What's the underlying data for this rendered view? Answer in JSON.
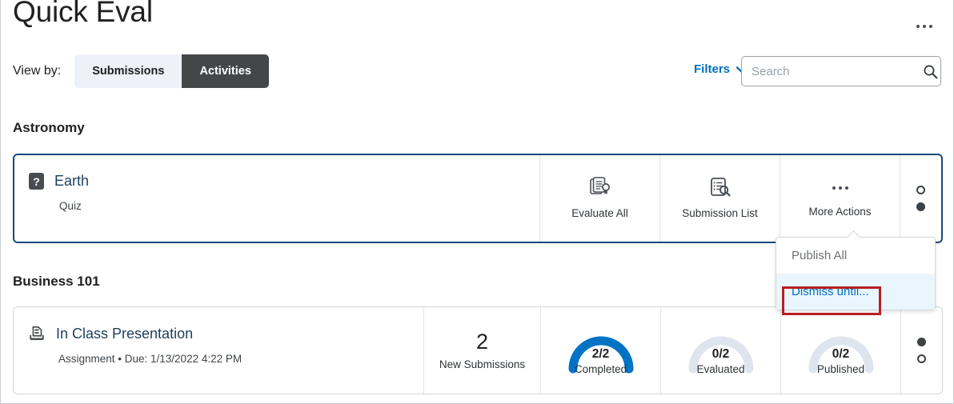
{
  "header": {
    "title": "Quick Eval",
    "overflow_icon": "ellipsis-horizontal-icon"
  },
  "toolbar": {
    "view_by_label": "View by:",
    "toggle": {
      "options": [
        {
          "label": "Submissions",
          "active": false
        },
        {
          "label": "Activities",
          "active": true
        }
      ]
    },
    "filters_label": "Filters",
    "filters_icon": "chevron-down-icon",
    "search": {
      "placeholder": "Search",
      "value": "",
      "icon": "search-icon"
    }
  },
  "groups": [
    {
      "course": "Astronomy",
      "card": {
        "focused": true,
        "type_icon": "quiz-icon",
        "type_icon_glyph": "?",
        "name": "Earth",
        "meta": "Quiz",
        "actions": [
          {
            "label": "Evaluate All",
            "icon": "evaluate-all-icon"
          },
          {
            "label": "Submission List",
            "icon": "submission-list-icon"
          },
          {
            "label": "More Actions",
            "icon": "ellipsis-horizontal-icon"
          }
        ],
        "pager_dots": [
          {
            "state": "hollow"
          },
          {
            "state": "filled"
          }
        ]
      }
    },
    {
      "course": "Business 101",
      "card": {
        "focused": false,
        "type_icon": "assignment-icon",
        "name": "In Class Presentation",
        "meta": "Assignment • Due: 1/13/2022 4:22 PM",
        "new_submissions": {
          "count": "2",
          "label": "New Submissions"
        },
        "gauges": [
          {
            "value": "2/2",
            "label": "Completed",
            "ratio": 1.0
          },
          {
            "value": "0/2",
            "label": "Evaluated",
            "ratio": 0.0
          },
          {
            "value": "0/2",
            "label": "Published",
            "ratio": 0.0
          }
        ],
        "pager_dots": [
          {
            "state": "filled"
          },
          {
            "state": "hollow"
          }
        ]
      }
    }
  ],
  "dropdown": {
    "items": [
      {
        "label": "Publish All",
        "state": "disabled"
      },
      {
        "label": "Dismiss until...",
        "state": "highlight"
      }
    ]
  },
  "colors": {
    "accent_blue": "#006fbf",
    "gauge_blue": "#0073c4",
    "gauge_track": "#dfe5ee",
    "active_toggle": "#444648",
    "focus_border": "#1a4a7a",
    "annotation_red": "#b81f25"
  }
}
